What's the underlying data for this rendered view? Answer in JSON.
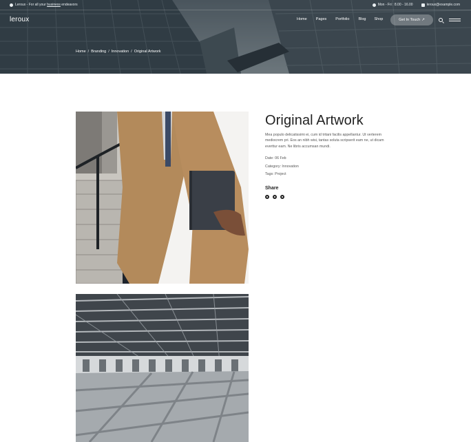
{
  "topbar": {
    "tagline_prefix": "Leroux - For all your ",
    "tagline_link": "business",
    "tagline_suffix": " endeavors",
    "hours": "Mon - Fri : 8.00 - 16.00",
    "email": "leroux@example.com"
  },
  "header": {
    "logo": "leroux",
    "nav": [
      "Home",
      "Pages",
      "Portfolio",
      "Blog",
      "Shop"
    ],
    "cta_label": "Get In Touch",
    "cta_arrow": "↗"
  },
  "breadcrumb": [
    "Home",
    "Branding",
    "Innovation",
    "Original Artwork"
  ],
  "project": {
    "title": "Original Artwork",
    "description": "Mea populo delicatissimi ei, cum id tritani facilis appellantur. Ut verterem mediocrem pri. Eos an nibh wisi, tantas soluta scripserit eam ne, ut dicam everttur eam. Ne libris accumsan mundi.",
    "date": "Date: 06 Feb",
    "category": "Category: Innovation",
    "tags": "Tags: Project",
    "share_heading": "Share",
    "social_icons": [
      "facebook-icon",
      "twitter-icon",
      "dribbble-icon"
    ]
  },
  "colors": {
    "text": "#222222",
    "muted": "#555555",
    "hero_overlay": "#3d4a52"
  }
}
